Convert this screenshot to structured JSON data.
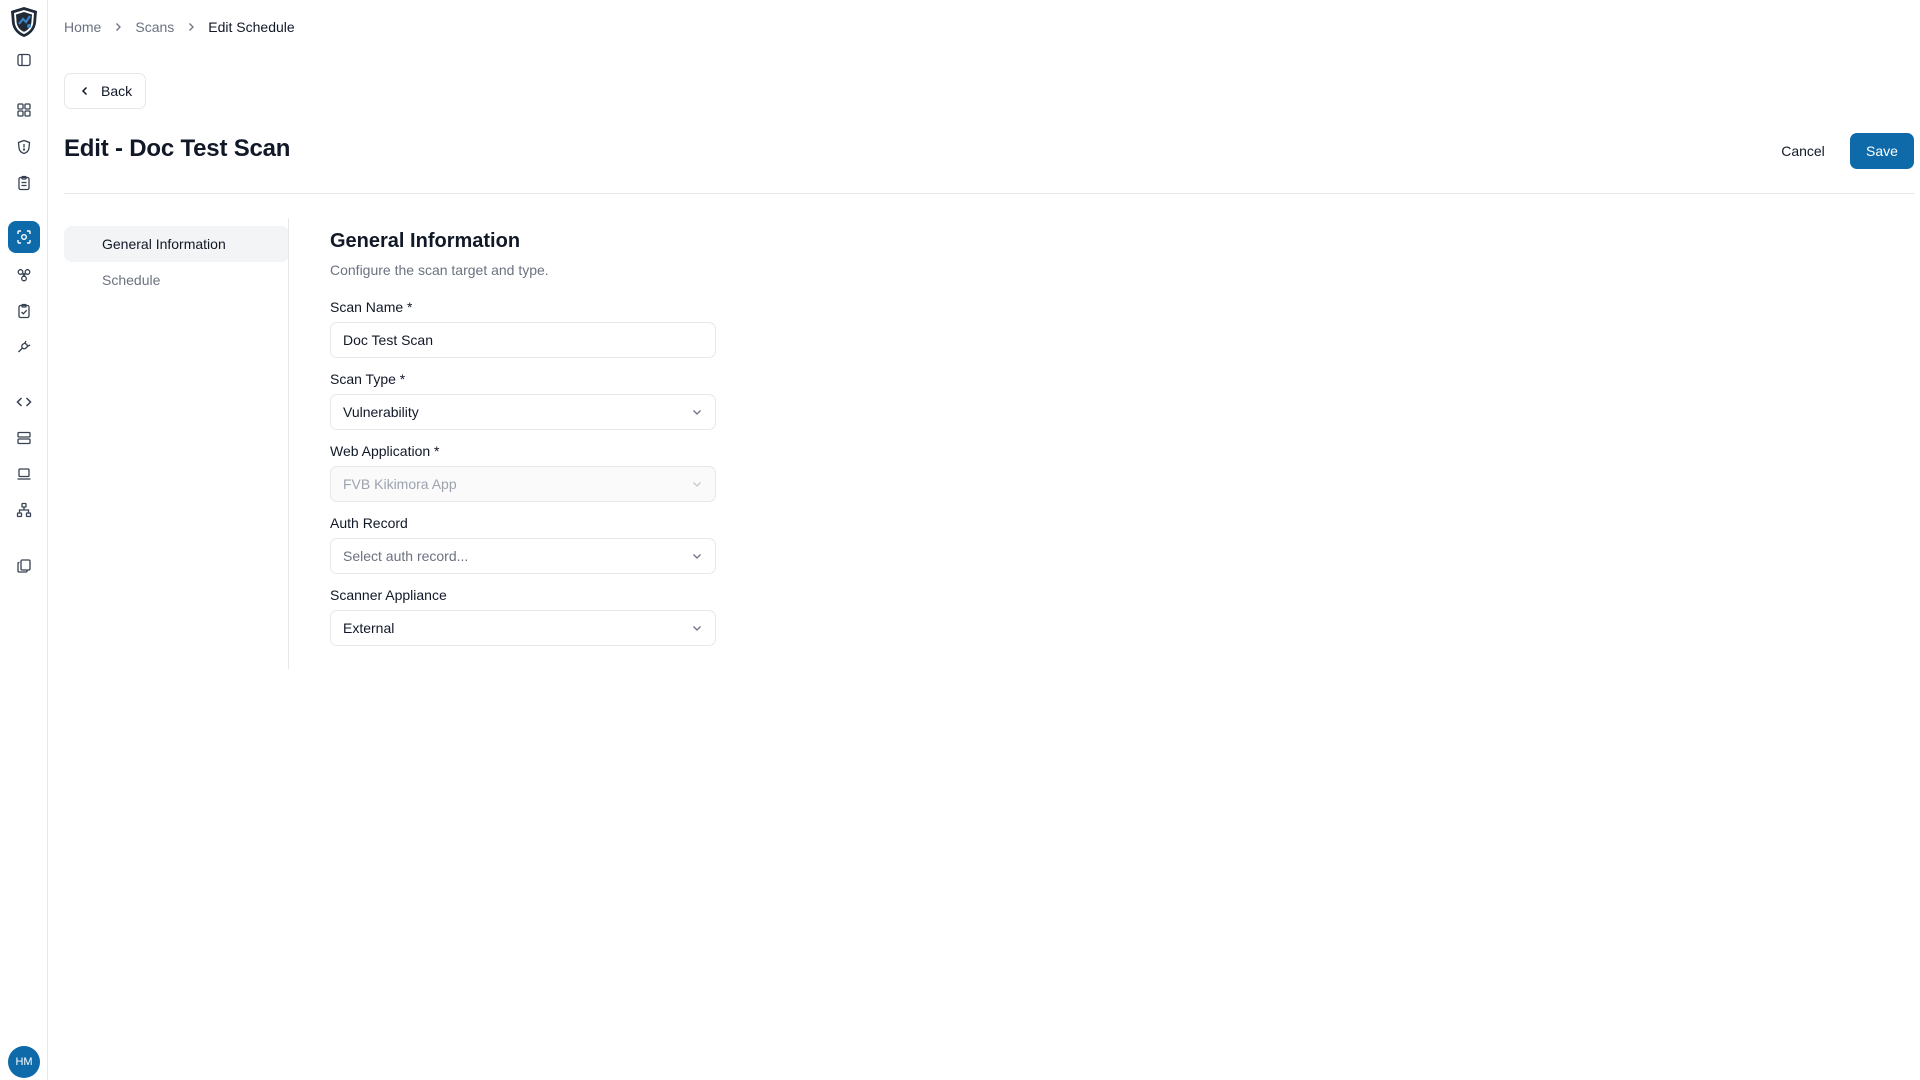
{
  "breadcrumb": {
    "home": "Home",
    "scans": "Scans",
    "current": "Edit Schedule"
  },
  "back_label": "Back",
  "page_title": "Edit - Doc Test Scan",
  "actions": {
    "cancel": "Cancel",
    "save": "Save"
  },
  "section_nav": {
    "general": "General Information",
    "schedule": "Schedule"
  },
  "form": {
    "heading": "General Information",
    "description": "Configure the scan target and type.",
    "scan_name": {
      "label": "Scan Name *",
      "value": "Doc Test Scan"
    },
    "scan_type": {
      "label": "Scan Type *",
      "value": "Vulnerability"
    },
    "web_application": {
      "label": "Web Application *",
      "value": "FVB Kikimora App"
    },
    "auth_record": {
      "label": "Auth Record",
      "placeholder": "Select auth record..."
    },
    "scanner_appliance": {
      "label": "Scanner Appliance",
      "value": "External"
    }
  },
  "user": {
    "initials": "HM"
  },
  "colors": {
    "accent": "#0e6aa8",
    "border": "#e5e7eb",
    "muted_text": "#6b7280"
  }
}
